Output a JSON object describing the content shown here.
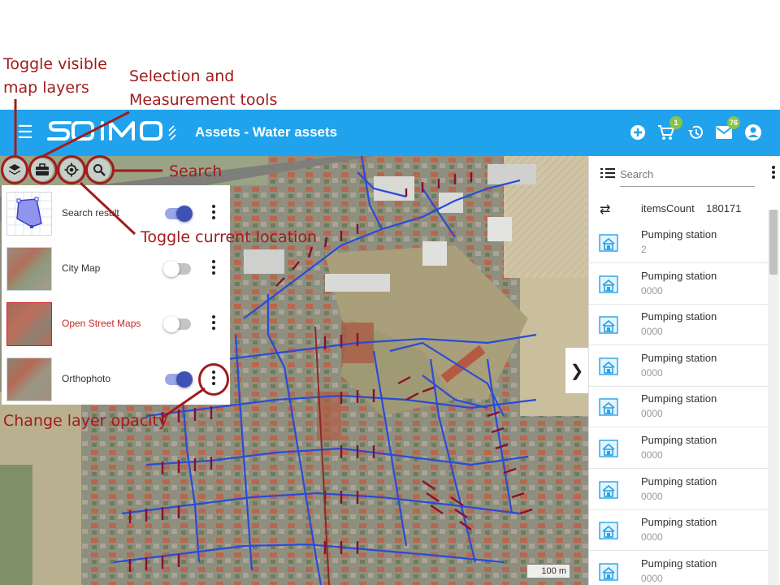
{
  "annotations": {
    "toggle_layers": [
      "Toggle visible",
      "map layers"
    ],
    "selection_tools": [
      "Selection and",
      "Measurement tools"
    ],
    "search": "Search",
    "toggle_location": "Toggle current location",
    "layer_opacity": "Change layer opacity"
  },
  "header": {
    "title": "Assets - Water assets",
    "cart_badge": "1",
    "mail_badge": "76",
    "background": "#20a3ec",
    "badge_color": "#8bc34a"
  },
  "layers": [
    {
      "name": "Search result",
      "enabled": true,
      "active": false
    },
    {
      "name": "City Map",
      "enabled": false,
      "active": false
    },
    {
      "name": "Open Street Maps",
      "enabled": false,
      "active": true
    },
    {
      "name": "Orthophoto",
      "enabled": true,
      "active": false
    }
  ],
  "right_panel": {
    "search_placeholder": "Search",
    "count_label": "itemsCount",
    "count_value": "180171",
    "items": [
      {
        "title": "Pumping station",
        "sub": "2"
      },
      {
        "title": "Pumping station",
        "sub": "0000"
      },
      {
        "title": "Pumping station",
        "sub": "0000"
      },
      {
        "title": "Pumping station",
        "sub": "0000"
      },
      {
        "title": "Pumping station",
        "sub": "0000"
      },
      {
        "title": "Pumping station",
        "sub": "0000"
      },
      {
        "title": "Pumping station",
        "sub": "0000"
      },
      {
        "title": "Pumping station",
        "sub": "0000"
      },
      {
        "title": "Pumping station",
        "sub": "0000"
      }
    ]
  },
  "map": {
    "scale_label": "100 m",
    "water_main_color": "#2a4bd7",
    "connection_color": "#8b0f2e"
  },
  "colors": {
    "annotation": "#a01c1c",
    "toggle_on": "#3f51b5",
    "active_layer_text": "#c62828"
  }
}
